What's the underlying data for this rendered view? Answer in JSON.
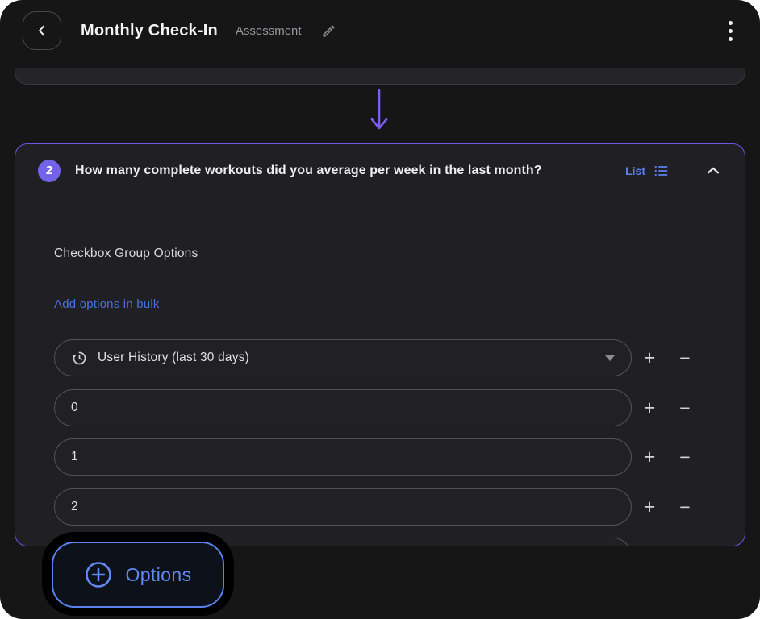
{
  "colors": {
    "accent_purple": "#7263e8",
    "card_border_purple": "#6a58e6",
    "accent_blue": "#5b82f0",
    "link_blue": "#4a70dd",
    "background": "#161617",
    "card_background": "#202024"
  },
  "header": {
    "title": "Monthly Check-In",
    "subtitle": "Assessment"
  },
  "icons": {
    "back": "chevron-left",
    "edit": "pencil",
    "menu": "kebab-vertical",
    "type": "list",
    "collapse": "chevron-up",
    "history": "history-clock",
    "dropdown": "caret-down",
    "connector": "arrow-down",
    "options": "plus-circle"
  },
  "question_card": {
    "number": "2",
    "question": "How many complete workouts did you average per week in the last month?",
    "type_label": "List",
    "section_title": "Checkbox Group Options",
    "bulk_add_link": "Add options in bulk",
    "options": [
      {
        "value": "User History (last 30 days)"
      },
      {
        "value": "0"
      },
      {
        "value": "1"
      },
      {
        "value": "2"
      }
    ],
    "add_button": "+",
    "remove_button": "−"
  },
  "footer": {
    "options_button": "Options"
  }
}
